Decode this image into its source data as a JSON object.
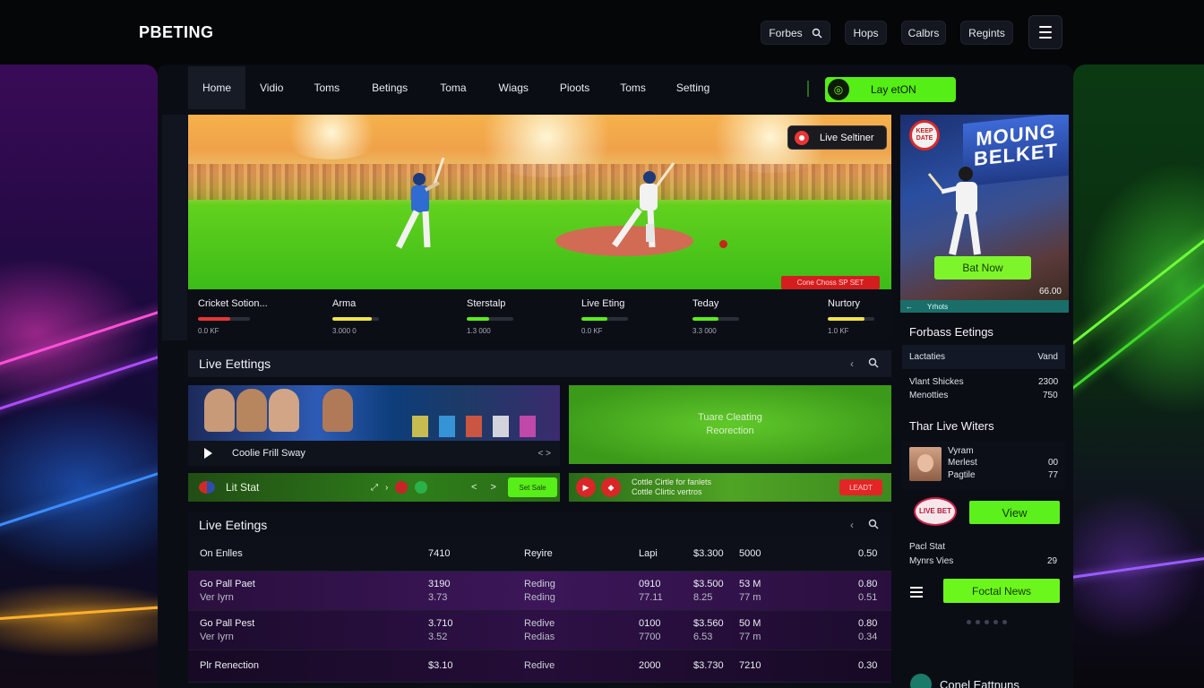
{
  "app": {
    "logo": "PBETING",
    "colors": {
      "accent_green": "#55ee17",
      "live_red": "#e32525",
      "panel": "#0a0d14"
    }
  },
  "topbar": {
    "buttons": [
      {
        "label": "Forbes",
        "icon": "search-icon"
      },
      {
        "label": "Hops"
      },
      {
        "label": "Calbrs"
      },
      {
        "label": "Regints"
      }
    ],
    "menu_icon": "hamburger-icon"
  },
  "nav": {
    "items": [
      "Home",
      "Vidio",
      "Toms",
      "Betings",
      "Toma",
      "Wiags",
      "Pioots",
      "Toms",
      "Setting"
    ],
    "active_index": 0,
    "live_cta": "Lay etON"
  },
  "hero": {
    "live_badge": "Live Seltiner",
    "tag": "Cone Choss SP SET"
  },
  "stats": [
    {
      "name": "Cricket Sotion...",
      "sub": "0.0 KF",
      "level": 0.62,
      "color": "#e83535"
    },
    {
      "name": "Arma",
      "sub": "3.000 0",
      "level": 0.85,
      "color": "#f3e34a"
    },
    {
      "name": "Sterstalp",
      "sub": "1.3 000",
      "level": 0.48,
      "color": "#58ee1a"
    },
    {
      "name": "Live Eting",
      "sub": "0.0 KF",
      "level": 0.56,
      "color": "#58ee1a"
    },
    {
      "name": "Teday",
      "sub": "3.3 000",
      "level": 0.55,
      "color": "#58ee1a"
    },
    {
      "name": "Nurtory",
      "sub": "1.0 KF",
      "level": 0.78,
      "color": "#f3e34a"
    }
  ],
  "live_section_1": {
    "title": "Live Eettings"
  },
  "card_a": {
    "title": "Coolie Frill Sway",
    "ends": "< >"
  },
  "card_b": {
    "line1": "Tuare Cleating",
    "line2": "Reorection"
  },
  "bar_a": {
    "label": "Lit Stat",
    "arrows": "< >",
    "button": "Set Sale"
  },
  "bar_b": {
    "line1": "Cottle Cirtle for fanlets",
    "line2": "Cottle Clirtic vertros",
    "button": "LEADT"
  },
  "live_section_2": {
    "title": "Live Eetings"
  },
  "table": {
    "header": {
      "name": "On Enlles",
      "c1": "7410",
      "c2": "Reyire",
      "c3": "Lapi",
      "c4": "$3.300",
      "c5": "5000",
      "c6": "0.50"
    },
    "rows": [
      {
        "name": "Go Pall Paet",
        "name2": "Ver Iyrn",
        "c1": "3190",
        "c1b": "3.73",
        "c2": "Reding",
        "c2b": "Reding",
        "c3": "0910",
        "c3b": "77.11",
        "c4": "$3.500",
        "c4b": "8.25",
        "c5": "53 M",
        "c5b": "77 m",
        "c6": "0.80",
        "c6b": "0.51"
      },
      {
        "name": "Go Pall Pest",
        "name2": "Ver Iyrn",
        "c1": "3.710",
        "c1b": "3.52",
        "c2": "Redive",
        "c2b": "Redias",
        "c3": "0100",
        "c3b": "7700",
        "c4": "$3.560",
        "c4b": "6.53",
        "c5": "50 M",
        "c5b": "77 m",
        "c6": "0.80",
        "c6b": "0.34"
      },
      {
        "name": "Plr Renection",
        "c1": "$3.10",
        "c2": "Redive",
        "c3": "2000",
        "c4": "$3.730",
        "c5": "7210",
        "c6": "0.30"
      }
    ]
  },
  "right": {
    "art_sign": "MOUNG BELKET",
    "art_badge": "KEEP DATE",
    "bet_button": "Bat Now",
    "odds": "66.00",
    "strip_label": "Yrhots",
    "forbass_title": "Forbass Eetings",
    "forbass_header": {
      "left": "Lactaties",
      "right": "Vand"
    },
    "forbass_rows": [
      {
        "left": "Vlant Shickes",
        "right": "2300"
      },
      {
        "left": "Menotties",
        "right": "750"
      }
    ],
    "winners_title": "Thar Live Witers",
    "winner": {
      "name1": "Vyram",
      "name2": "Merlest",
      "name3": "Pagtile",
      "v1": "00",
      "v2": "77"
    },
    "logo_text": "LIVE BET",
    "view_button": "View",
    "pacet": {
      "label": "Pacl Stat",
      "sub": "Mynrs Vies",
      "value": "29"
    },
    "news_button": "Foctal News",
    "footer_title": "Conel Eattnuns"
  }
}
